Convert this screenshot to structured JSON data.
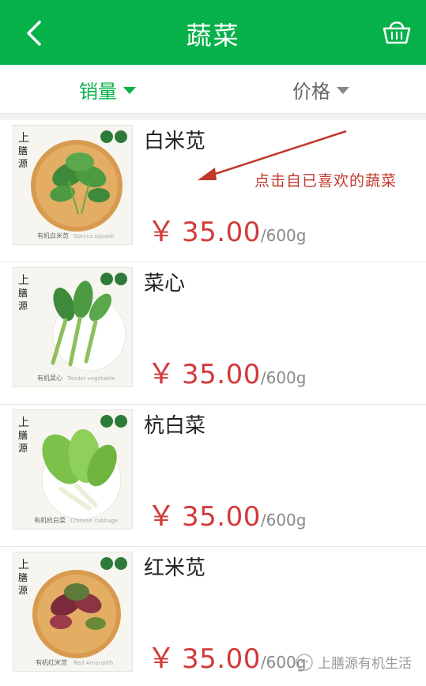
{
  "header": {
    "title": "蔬菜",
    "back_icon": "chevron-left-icon",
    "basket_icon": "basket-icon",
    "bg_color": "#07b14a"
  },
  "sort": {
    "sales_label": "销量",
    "price_label": "价格",
    "active_color": "#07b14a"
  },
  "annotation": {
    "hint_text": "点击自已喜欢的蔬菜",
    "color": "#c0392b"
  },
  "products": [
    {
      "name": "白米苋",
      "currency": "￥",
      "price": "35.00",
      "unit": "/600g",
      "brand_mark": "上膳源",
      "thumb_caption_cn": "有机白米苋",
      "thumb_caption_en": "Gorcca squash"
    },
    {
      "name": "菜心",
      "currency": "￥",
      "price": "35.00",
      "unit": "/600g",
      "brand_mark": "上膳源",
      "thumb_caption_cn": "有机菜心",
      "thumb_caption_en": "Tender vegetable"
    },
    {
      "name": "杭白菜",
      "currency": "￥",
      "price": "35.00",
      "unit": "/600g",
      "brand_mark": "上膳源",
      "thumb_caption_cn": "有机杭白菜",
      "thumb_caption_en": "Chinese cabbage"
    },
    {
      "name": "红米苋",
      "currency": "￥",
      "price": "35.00",
      "unit": "/600g",
      "brand_mark": "上膳源",
      "thumb_caption_cn": "有机红米苋",
      "thumb_caption_en": "Red Amaranth"
    }
  ],
  "watermark": {
    "text": "上膳源有机生活"
  }
}
